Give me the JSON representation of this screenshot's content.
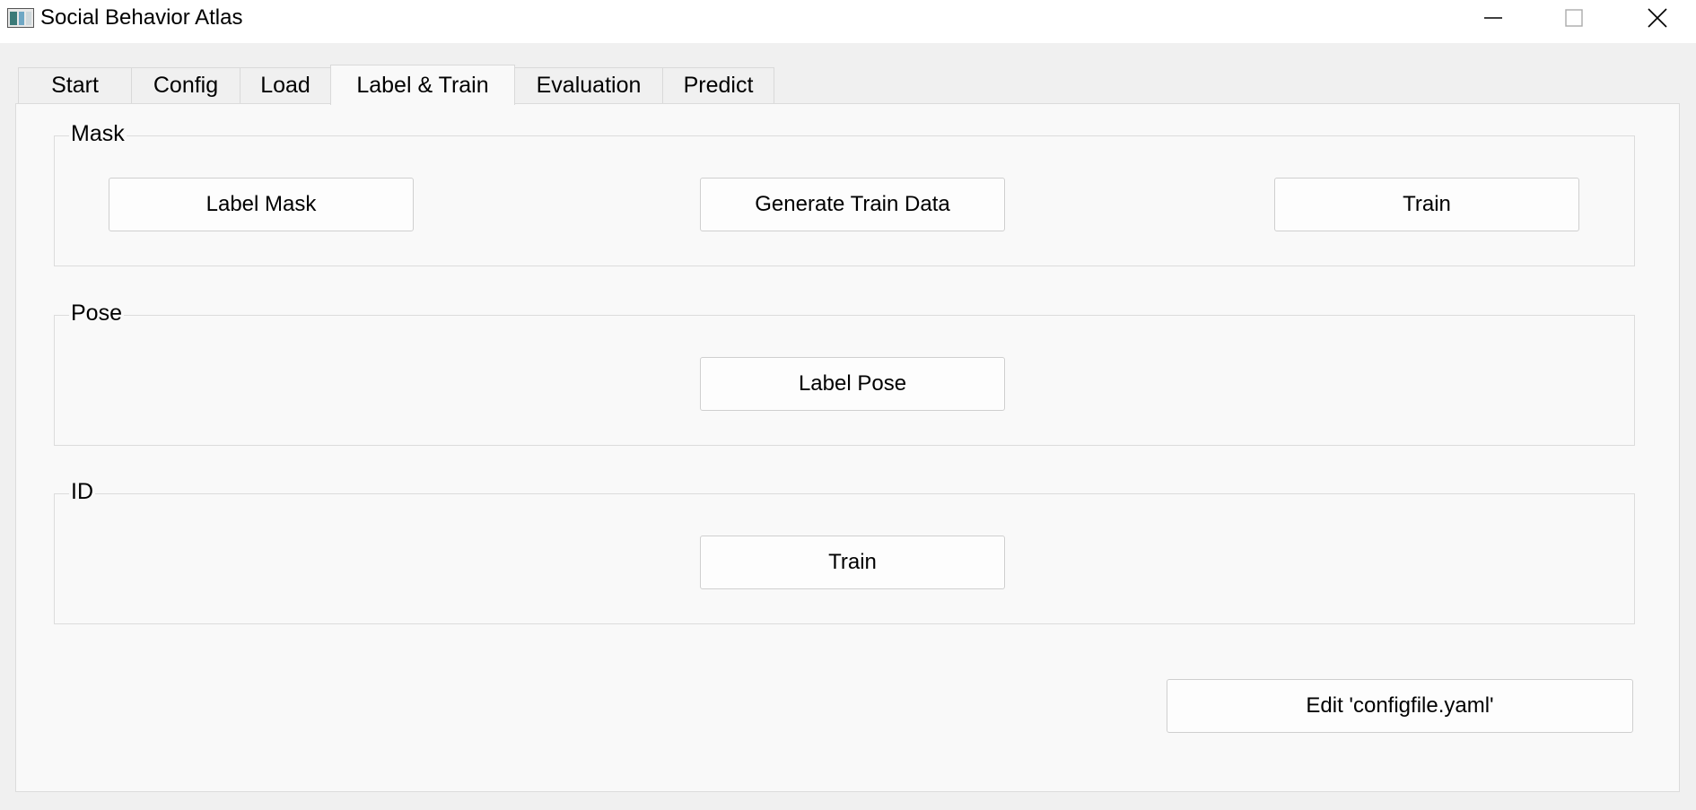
{
  "window": {
    "title": "Social Behavior Atlas",
    "app_icon": "app-icon",
    "minimize_icon": "minimize-icon",
    "maximize_icon": "maximize-icon",
    "close_icon": "close-icon"
  },
  "tabs": [
    {
      "label": "Start"
    },
    {
      "label": "Config"
    },
    {
      "label": "Load"
    },
    {
      "label": "Label & Train",
      "active": true
    },
    {
      "label": "Evaluation"
    },
    {
      "label": "Predict"
    }
  ],
  "groups": {
    "mask": {
      "title": "Mask",
      "buttons": [
        "Label Mask",
        "Generate Train Data",
        "Train"
      ]
    },
    "pose": {
      "title": "Pose",
      "buttons": [
        "Label Pose"
      ]
    },
    "id": {
      "title": "ID",
      "buttons": [
        "Train"
      ]
    }
  },
  "edit_config_button": "Edit 'configfile.yaml'",
  "colors": {
    "window_bg": "#f0f0f0",
    "panel_bg": "#f9f9f9",
    "button_bg": "#fdfdfd",
    "border": "#dcdcdc"
  }
}
